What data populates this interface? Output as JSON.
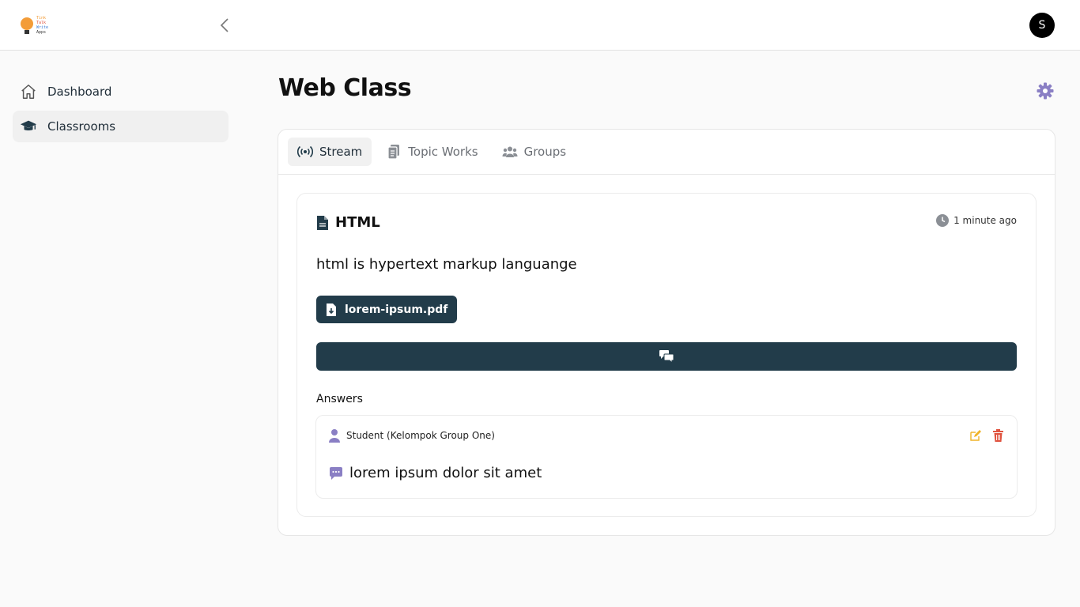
{
  "app": {
    "logo_lines": [
      "Tink",
      "Talk",
      "Write",
      "Apps"
    ],
    "user_initial": "S"
  },
  "sidebar": {
    "items": [
      {
        "label": "Dashboard",
        "icon": "home-icon",
        "active": false
      },
      {
        "label": "Classrooms",
        "icon": "graduation-cap-icon",
        "active": true
      }
    ]
  },
  "page": {
    "title": "Web Class"
  },
  "tabs": [
    {
      "label": "Stream",
      "icon": "broadcast-icon",
      "active": true
    },
    {
      "label": "Topic Works",
      "icon": "documents-icon",
      "active": false
    },
    {
      "label": "Groups",
      "icon": "users-icon",
      "active": false
    }
  ],
  "post": {
    "title": "HTML",
    "time": "1 minute ago",
    "description": "html is hypertext markup languange",
    "attachment": "lorem-ipsum.pdf"
  },
  "answers": {
    "label": "Answers",
    "items": [
      {
        "author": "Student (Kelompok Group One)",
        "text": "lorem ipsum dolor sit amet"
      }
    ]
  },
  "colors": {
    "primary_dark": "#223c4a",
    "accent_purple": "#8a7fc4",
    "edit_yellow": "#f0b429",
    "delete_red": "#e0533f"
  }
}
